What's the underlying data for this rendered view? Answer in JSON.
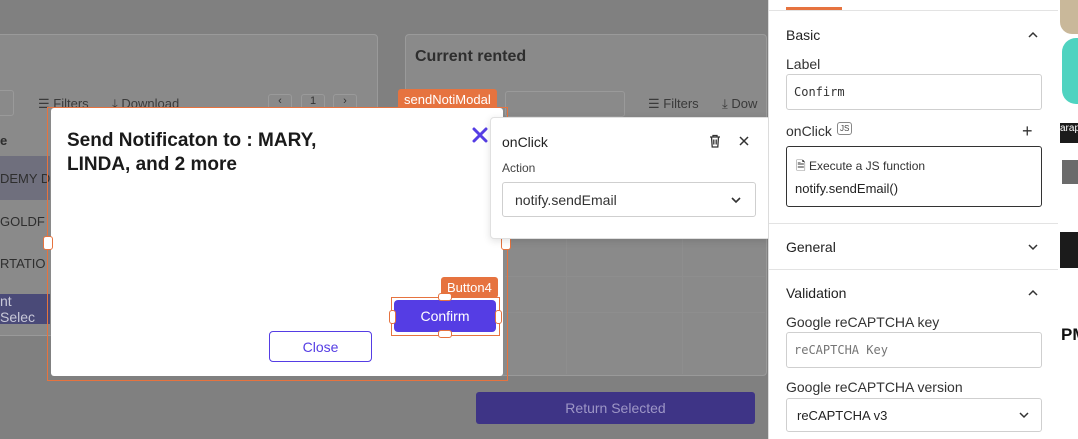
{
  "canvas": {
    "left_toolbar": {
      "filters": "Filters",
      "download": "Download",
      "page": "1"
    },
    "left_rows": [
      "DEMY D",
      "GOLDF",
      "RTATIO"
    ],
    "left_col_head": "e",
    "left_button": "nt Selec",
    "current_rented": {
      "title": "Current rented",
      "filters": "Filters",
      "download": "Dow",
      "return_button": "Return Selected"
    }
  },
  "modal": {
    "tag": "sendNotiModal",
    "title": "Send Notificaton to : MARY, LINDA, and 2 more",
    "close_icon": "close-x-icon",
    "confirm_tag": "Button4",
    "confirm_label": "Confirm",
    "close_label": "Close",
    "accent": "#553de4",
    "selection_color": "#e6733f"
  },
  "popover": {
    "title": "onClick",
    "action_label": "Action",
    "action_value": "notify.sendEmail"
  },
  "props": {
    "basic": {
      "title": "Basic",
      "label_label": "Label",
      "label_value": "Confirm",
      "onclick_label": "onClick",
      "js_badge": "JS",
      "exec_label": "Execute a JS function",
      "exec_value": "notify.sendEmail()"
    },
    "general": {
      "title": "General"
    },
    "validation": {
      "title": "Validation",
      "key_label": "Google reCAPTCHA key",
      "key_placeholder": "reCAPTCHA Key",
      "version_label": "Google reCAPTCHA version",
      "version_value": "reCAPTCHA v3"
    }
  },
  "strip": {
    "text1": "arap",
    "text2": "PM"
  }
}
